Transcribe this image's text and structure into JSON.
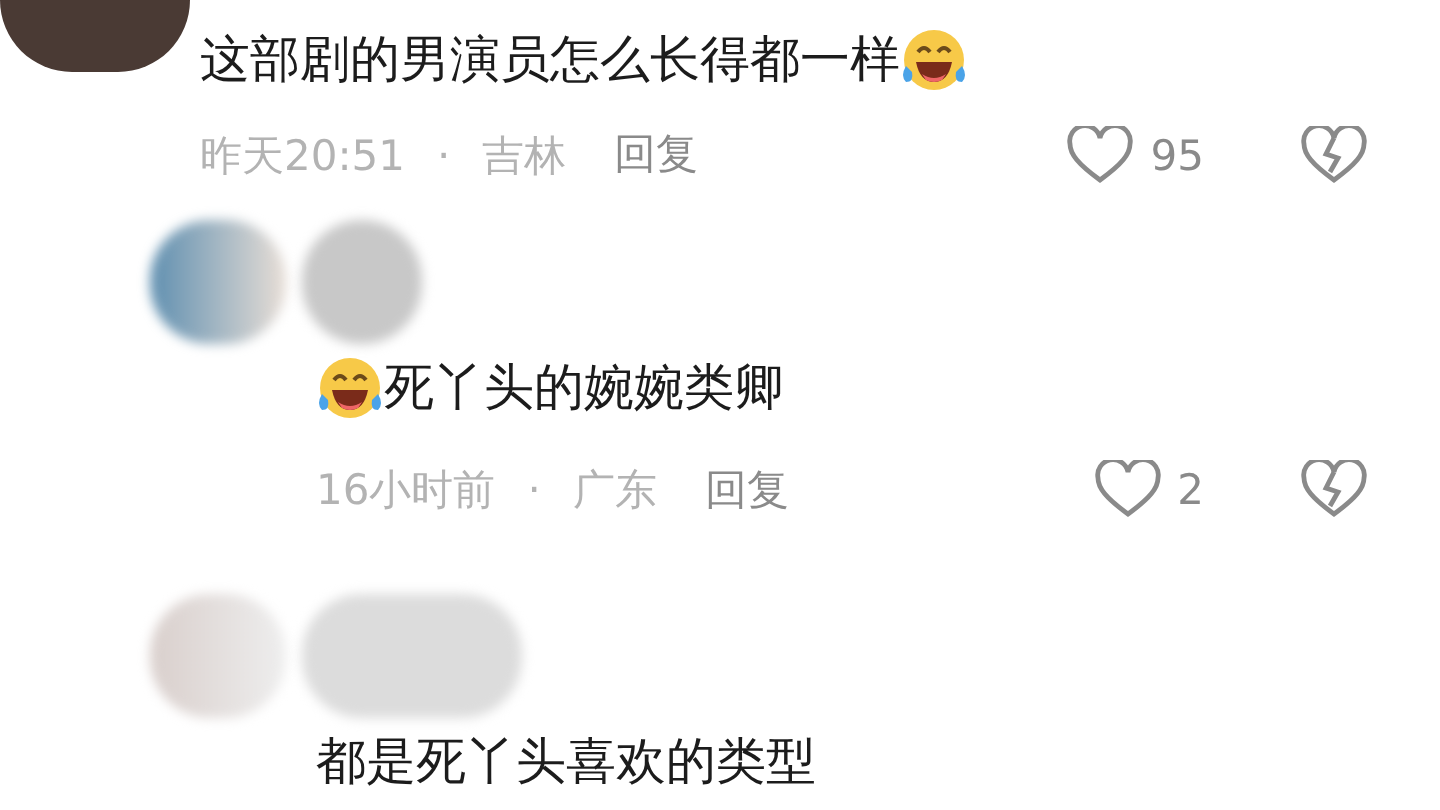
{
  "comments": [
    {
      "kind": "comment",
      "text": "这部剧的男演员怎么长得都一样",
      "emoji_before": false,
      "emoji_after": true,
      "time": "昨天20:51",
      "separator": "·",
      "location": "吉林",
      "reply_label": "回复",
      "likes": "95"
    },
    {
      "kind": "reply",
      "text": "死丫头的婉婉类卿",
      "emoji_before": true,
      "emoji_after": false,
      "time": "16小时前",
      "separator": "·",
      "location": "广东",
      "reply_label": "回复",
      "likes": "2"
    },
    {
      "kind": "reply",
      "text": "都是死丫头喜欢的类型",
      "emoji_before": false,
      "emoji_after": false
    }
  ]
}
